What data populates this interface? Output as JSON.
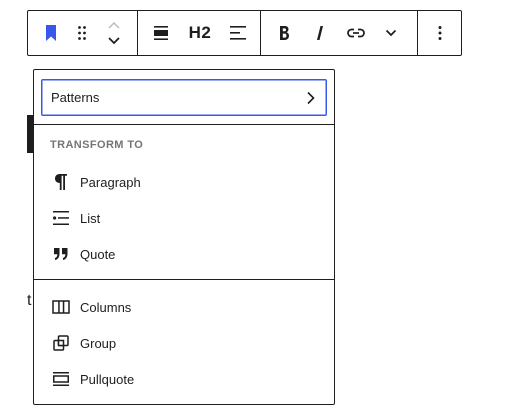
{
  "toolbar": {
    "heading_level": "H2"
  },
  "background": {
    "fragment_letter": "t"
  },
  "dropdown": {
    "patterns_label": "Patterns",
    "section_title": "TRANSFORM TO",
    "transform_items": [
      {
        "label": "Paragraph",
        "icon": "paragraph-icon"
      },
      {
        "label": "List",
        "icon": "list-icon"
      },
      {
        "label": "Quote",
        "icon": "quote-icon"
      }
    ],
    "other_items": [
      {
        "label": "Columns",
        "icon": "columns-icon"
      },
      {
        "label": "Group",
        "icon": "group-icon"
      },
      {
        "label": "Pullquote",
        "icon": "pullquote-icon"
      }
    ]
  },
  "colors": {
    "accent": "#3858e9",
    "text": "#1e1e1e",
    "muted": "#757575"
  }
}
